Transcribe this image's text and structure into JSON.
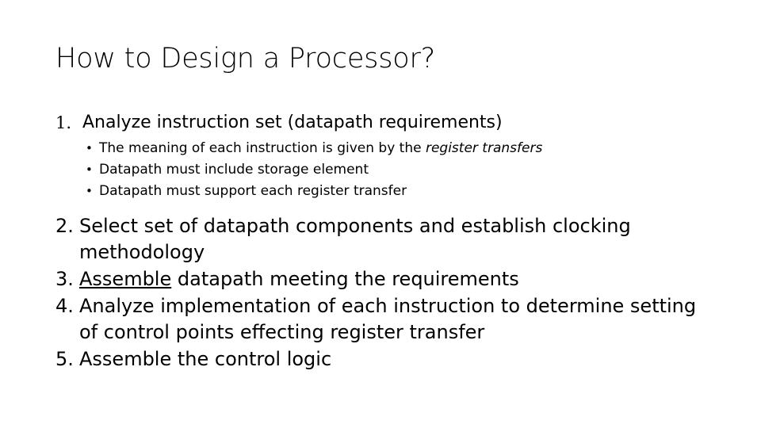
{
  "slide": {
    "title": "How to Design a Processor?",
    "first_item": {
      "number": "1.",
      "text": "Analyze instruction set (datapath requirements)",
      "bullets": [
        {
          "marker": "•",
          "text_plain": "The meaning of each instruction is given by the ",
          "text_italic": "register transfers"
        },
        {
          "marker": "•",
          "text_plain": "Datapath must include storage element",
          "text_italic": ""
        },
        {
          "marker": "•",
          "text_plain": "Datapath must support each register transfer",
          "text_italic": ""
        }
      ]
    },
    "items": [
      {
        "number": "2.",
        "text": "Select set of datapath components and establish clocking methodology"
      },
      {
        "number": "3.",
        "text_underlined": " Assemble",
        "text_rest": " datapath meeting the requirements"
      },
      {
        "number": "4.",
        "text": "Analyze implementation of each instruction to determine setting of control points effecting register transfer"
      },
      {
        "number": "5.",
        "text": "Assemble the control logic"
      }
    ]
  }
}
